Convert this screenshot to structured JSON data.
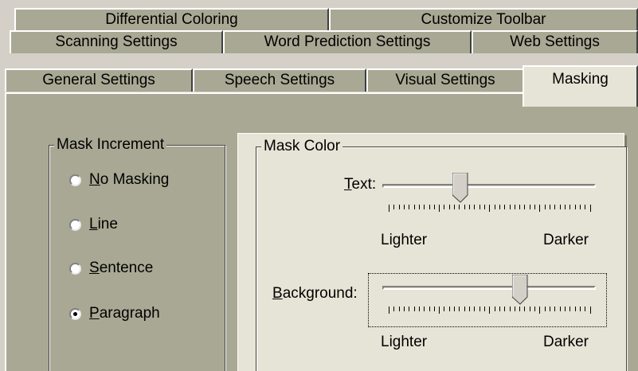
{
  "tabs": {
    "row1": [
      {
        "label": "Differential Coloring"
      },
      {
        "label": "Customize Toolbar"
      }
    ],
    "row2": [
      {
        "label": "Scanning Settings"
      },
      {
        "label": "Word Prediction Settings"
      },
      {
        "label": "Web Settings"
      }
    ],
    "row3": [
      {
        "label": "General Settings"
      },
      {
        "label": "Speech Settings"
      },
      {
        "label": "Visual Settings"
      },
      {
        "label": "Masking"
      }
    ],
    "active": "Masking"
  },
  "mask_increment": {
    "legend": "Mask Increment",
    "options": [
      {
        "mnemonic": "N",
        "rest": "o Masking",
        "checked": false
      },
      {
        "mnemonic": "L",
        "rest": "ine",
        "checked": false
      },
      {
        "mnemonic": "S",
        "rest": "entence",
        "checked": false
      },
      {
        "mnemonic": "P",
        "rest": "aragraph",
        "checked": true
      }
    ]
  },
  "mask_color": {
    "legend": "Mask Color",
    "text_slider": {
      "mnemonic": "T",
      "rest": "ext:",
      "min_label": "Lighter",
      "max_label": "Darker",
      "value": 0.36
    },
    "background_slider": {
      "mnemonic": "B",
      "rest": "ackground:",
      "min_label": "Lighter",
      "max_label": "Darker",
      "value": 0.66
    }
  },
  "colors": {
    "tab_bg": "#a8a894",
    "active_tab_bg": "#e6e4d6",
    "panel_bg": "#e6e4d6"
  }
}
